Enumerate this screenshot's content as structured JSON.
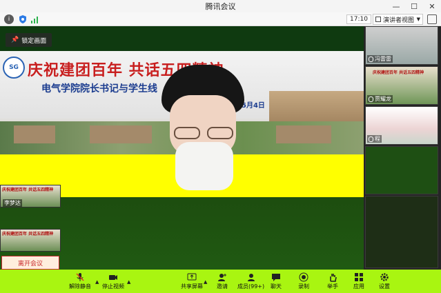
{
  "window": {
    "title": "腾讯会议",
    "controls": [
      "—",
      "☐",
      "✕"
    ]
  },
  "status": {
    "timer": "17:10",
    "view_label": "演讲者视图"
  },
  "stage": {
    "lock_label": "锁定画面",
    "slide": {
      "logo": "SG",
      "headline": "庆祝建团百年    共话五四精神",
      "subline": "电气学院院长书记与学生线",
      "date": "年5月4日"
    }
  },
  "left_strip": {
    "thumb_text": "庆祝建团百年  共话五四精神",
    "name": "李梦达",
    "leave_label": "离开会议"
  },
  "participants": [
    {
      "name": "冯雷雷"
    },
    {
      "name": "贾耀龙",
      "thumb_text": "庆祝建团百年  共话五四精神"
    },
    {
      "name": "程"
    }
  ],
  "toolbar": {
    "unmute": "解除静音",
    "stop_video": "停止视频",
    "share": "共享屏幕",
    "invite": "邀请",
    "members": "成员(99+)",
    "chat": "聊天",
    "record": "录制",
    "raise_hand": "举手",
    "apps": "应用",
    "settings": "设置"
  },
  "colors": {
    "toolbar_bg": "#a9f511",
    "accent_yellow": "#ffff00",
    "leave_red": "#c8282b",
    "headline_red": "#c81e1e",
    "subline_blue": "#1b3c8f"
  }
}
